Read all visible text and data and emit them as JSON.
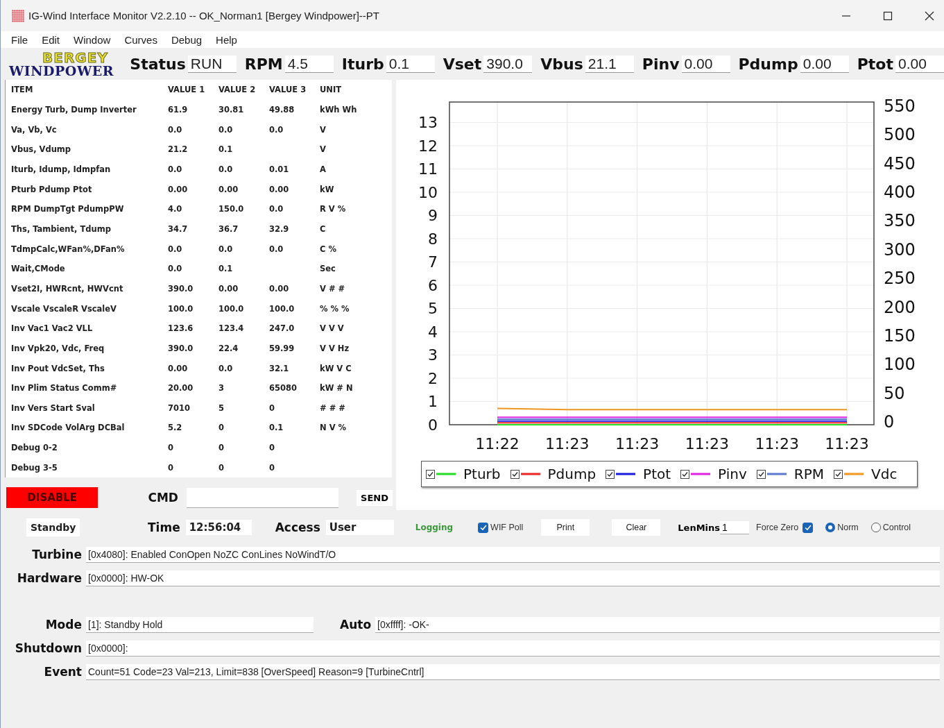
{
  "window": {
    "title": "IG-Wind Interface Monitor V2.2.10 -- OK_Norman1 [Bergey Windpower]--PT"
  },
  "menu": [
    "File",
    "Edit",
    "Window",
    "Curves",
    "Debug",
    "Help"
  ],
  "logo": {
    "top": "BERGEY",
    "bottom": "WINDPOWER"
  },
  "readouts": [
    {
      "label": "Status",
      "value": "RUN"
    },
    {
      "label": "RPM",
      "value": "4.5"
    },
    {
      "label": "Iturb",
      "value": "0.1"
    },
    {
      "label": "Vset",
      "value": "390.0"
    },
    {
      "label": "Vbus",
      "value": "21.1"
    },
    {
      "label": "Pinv",
      "value": "0.00"
    },
    {
      "label": "Pdump",
      "value": "0.00"
    },
    {
      "label": "Ptot",
      "value": "0.00"
    }
  ],
  "table": {
    "columns": [
      "ITEM",
      "VALUE 1",
      "VALUE 2",
      "VALUE 3",
      "UNIT"
    ],
    "rows": [
      [
        "Energy Turb, Dump Inverter",
        "61.9",
        "30.81",
        "49.88",
        "kWh Wh"
      ],
      [
        "Va, Vb, Vc",
        "0.0",
        "0.0",
        "0.0",
        "V"
      ],
      [
        "Vbus, Vdump",
        "21.2",
        "0.1",
        "",
        "V"
      ],
      [
        "Iturb, Idump, Idmpfan",
        "0.0",
        "0.0",
        "0.01",
        "A"
      ],
      [
        "Pturb Pdump Ptot",
        "0.00",
        "0.00",
        "0.00",
        "kW"
      ],
      [
        "RPM DumpTgt PdumpPW",
        "4.0",
        "150.0",
        "0.0",
        "R V %"
      ],
      [
        "Ths, Tambient, Tdump",
        "34.7",
        "36.7",
        "32.9",
        "C"
      ],
      [
        "TdmpCalc,WFan%,DFan%",
        "0.0",
        "0.0",
        "0.0",
        "C %"
      ],
      [
        "Wait,CMode",
        "0.0",
        "0.1",
        "",
        "Sec"
      ],
      [
        "Vset2I, HWRcnt, HWVcnt",
        "390.0",
        "0.00",
        "0.00",
        "V # #"
      ],
      [
        "Vscale VscaleR VscaleV",
        "100.0",
        "100.0",
        "100.0",
        "% % %"
      ],
      [
        "Inv Vac1 Vac2 VLL",
        "123.6",
        "123.4",
        "247.0",
        "V V V"
      ],
      [
        "Inv Vpk20, Vdc, Freq",
        "390.0",
        "22.4",
        "59.99",
        "V V Hz"
      ],
      [
        "Inv Pout VdcSet, Ths",
        "0.00",
        "0.0",
        "32.1",
        "kW V C"
      ],
      [
        "Inv Plim Status Comm#",
        "20.00",
        "3",
        "65080",
        "kW # N"
      ],
      [
        "Inv Vers Start Sval",
        "7010",
        "5",
        "0",
        "# # #"
      ],
      [
        "Inv SDCode VolArg DCBal",
        "5.2",
        "0",
        "0.1",
        "N V %"
      ],
      [
        "Debug 0-2",
        "0",
        "0",
        "0",
        ""
      ],
      [
        "Debug 3-5",
        "0",
        "0",
        "0",
        ""
      ]
    ]
  },
  "chart": {
    "right_axis_labels": [
      "550",
      "500",
      "450",
      "400",
      "350",
      "300",
      "250",
      "200",
      "150",
      "100",
      "50",
      "0"
    ],
    "chart_data": {
      "type": "line",
      "categories": [
        "11:22",
        "11:23",
        "11:23",
        "11:23",
        "11:23",
        "11:23"
      ],
      "ylim": [
        0,
        13.88
      ],
      "yticks": [
        13,
        12,
        11,
        10,
        9,
        8,
        7,
        6,
        5,
        4,
        3,
        2,
        1,
        0
      ],
      "grid": true,
      "series": [
        {
          "name": "Pturb",
          "color": "#22dd22",
          "values": [
            0,
            0,
            0,
            0,
            0,
            0
          ]
        },
        {
          "name": "Pdump",
          "color": "#ee2222",
          "values": [
            0.08,
            0.08,
            0.08,
            0.08,
            0.08,
            0.08
          ]
        },
        {
          "name": "Ptot",
          "color": "#1a1ae0",
          "values": [
            0.16,
            0.16,
            0.16,
            0.16,
            0.16,
            0.16
          ]
        },
        {
          "name": "Pinv",
          "color": "#e020e0",
          "values": [
            0.32,
            0.32,
            0.32,
            0.32,
            0.32,
            0.32
          ]
        },
        {
          "name": "RPM",
          "color": "#5a78d0",
          "values": [
            0.24,
            0.24,
            0.24,
            0.24,
            0.24,
            0.24
          ]
        },
        {
          "name": "Vdc",
          "color": "#f0961e",
          "values": [
            0.7,
            0.65,
            0.65,
            0.65,
            0.65,
            0.65
          ]
        }
      ]
    },
    "legend": [
      {
        "checked": true
      },
      {
        "checked": true
      },
      {
        "checked": true
      },
      {
        "checked": true
      },
      {
        "checked": true
      },
      {
        "checked": true
      }
    ]
  },
  "disable_button": "DISABLE",
  "cmd": {
    "label": "CMD"
  },
  "send_button": "SEND",
  "standby_button": "Standby",
  "time": {
    "label": "Time",
    "value": "12:56:04"
  },
  "access": {
    "label": "Access",
    "value": "User"
  },
  "logging": "Logging",
  "wif_poll": {
    "label": "WIF Poll",
    "checked": true
  },
  "print_button": "Print",
  "clear_button": "Clear",
  "len_mins": {
    "label": "LenMins",
    "value": "1"
  },
  "force_zero": {
    "label": "Force Zero",
    "checked": true
  },
  "modes": [
    {
      "label": "Norm",
      "selected": true
    },
    {
      "label": "Control",
      "selected": false
    }
  ],
  "status_rows": [
    {
      "fields": [
        {
          "label": "Turbine",
          "value": "[0x4080]: Enabled ConOpen NoZC ConLines NoWindT/O"
        }
      ]
    },
    {
      "fields": [
        {
          "label": "Hardware",
          "value": "[0x0000]: HW-OK"
        }
      ]
    },
    {
      "fields": [
        {
          "label": "Mode",
          "value": "[1]: Standby Hold"
        },
        {
          "label": "Auto",
          "value": "[0xffff]: -OK-"
        }
      ]
    },
    {
      "fields": [
        {
          "label": "Shutdown",
          "value": "[0x0000]:"
        }
      ]
    },
    {
      "fields": [
        {
          "label": "Event",
          "value": "Count=51 Code=23 Val=213, Limit=838 [OverSpeed]   Reason=9 [TurbineCntrl]"
        }
      ]
    }
  ]
}
